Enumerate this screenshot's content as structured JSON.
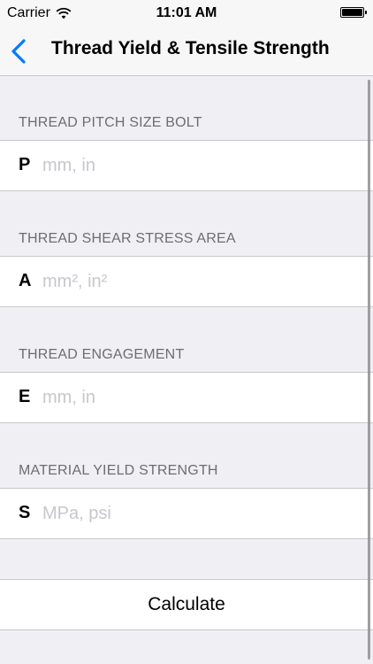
{
  "status_bar": {
    "carrier": "Carrier",
    "time": "11:01 AM",
    "icons": [
      "wifi-icon",
      "battery-icon"
    ]
  },
  "nav": {
    "back_icon": "chevron-left-icon",
    "title": "Thread Yield & Tensile Strength"
  },
  "sections": [
    {
      "header": "THREAD PITCH SIZE BOLT",
      "letter": "P",
      "placeholder": "mm, in",
      "value": ""
    },
    {
      "header": "THREAD SHEAR STRESS AREA",
      "letter": "A",
      "placeholder": "mm², in²",
      "value": ""
    },
    {
      "header": "THREAD ENGAGEMENT",
      "letter": "E",
      "placeholder": "mm, in",
      "value": ""
    },
    {
      "header": "MATERIAL YIELD STRENGTH",
      "letter": "S",
      "placeholder": "MPa, psi",
      "value": ""
    }
  ],
  "calculate": {
    "label": "Calculate"
  },
  "colors": {
    "accent": "#007aff",
    "background": "#efeff4",
    "header_text": "#6d6d72",
    "placeholder": "#c7c7cd",
    "separator": "#c8c7cc"
  }
}
